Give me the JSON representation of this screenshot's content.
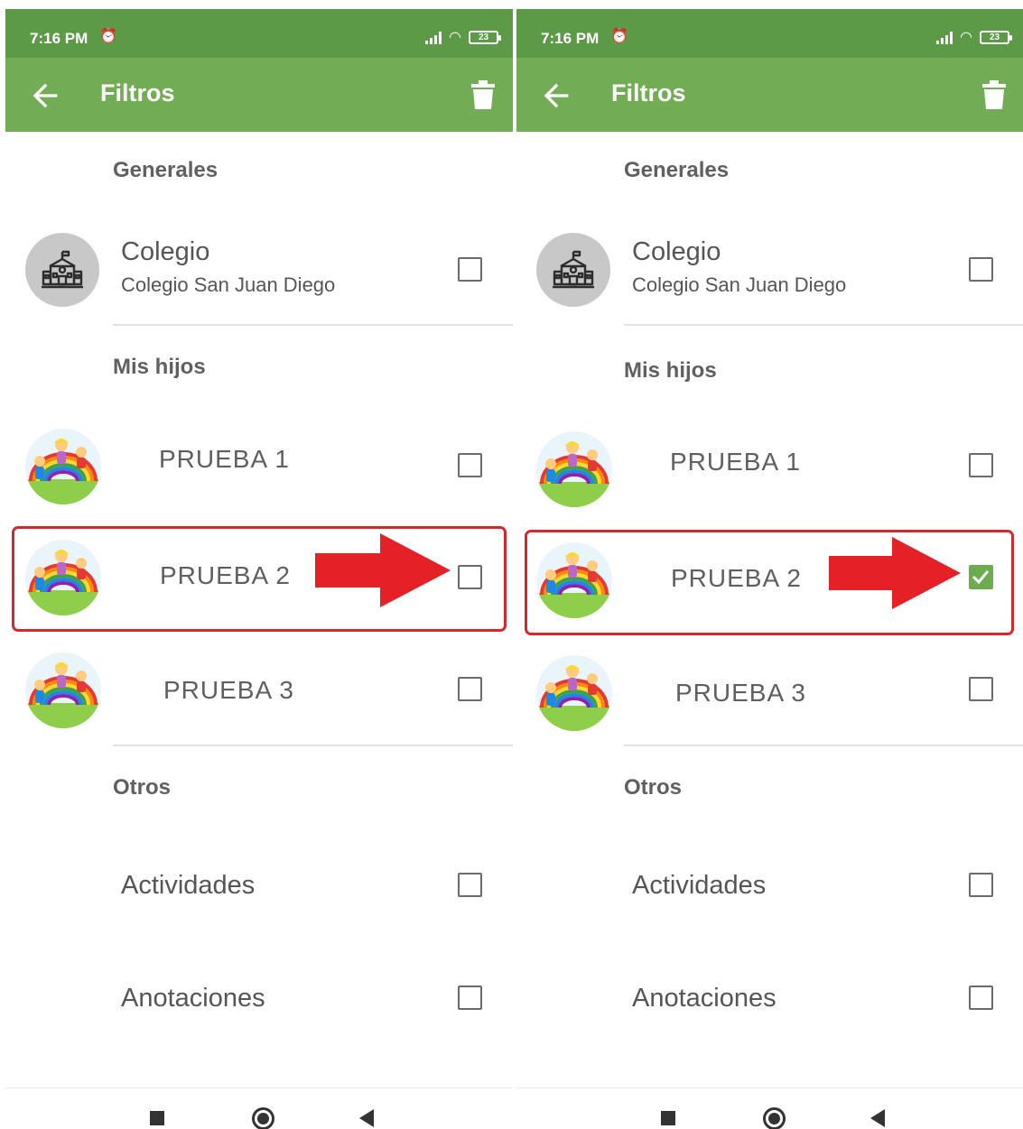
{
  "screens": [
    {
      "status_time": "7:16 PM",
      "battery": "23",
      "title": "Filtros",
      "sections": {
        "general": "Generales",
        "children": "Mis hijos",
        "others": "Otros"
      },
      "school": {
        "title": "Colegio",
        "subtitle": "Colegio San Juan Diego",
        "checked": false
      },
      "children": [
        {
          "name": "PRUEBA 1",
          "checked": false
        },
        {
          "name": "PRUEBA 2",
          "checked": false
        },
        {
          "name": "PRUEBA 3",
          "checked": false
        }
      ],
      "others": [
        {
          "label": "Actividades",
          "checked": false
        },
        {
          "label": "Anotaciones",
          "checked": false
        }
      ]
    },
    {
      "status_time": "7:16 PM",
      "battery": "23",
      "title": "Filtros",
      "sections": {
        "general": "Generales",
        "children": "Mis hijos",
        "others": "Otros"
      },
      "school": {
        "title": "Colegio",
        "subtitle": "Colegio San Juan Diego",
        "checked": false
      },
      "children": [
        {
          "name": "PRUEBA 1",
          "checked": false
        },
        {
          "name": "PRUEBA 2",
          "checked": true
        },
        {
          "name": "PRUEBA 3",
          "checked": false
        }
      ],
      "others": [
        {
          "label": "Actividades",
          "checked": false
        },
        {
          "label": "Anotaciones",
          "checked": false
        }
      ]
    }
  ],
  "icons": {
    "back": "arrow-back-icon",
    "trash": "trash-icon",
    "school": "school-building-icon",
    "child_avatar": "kids-rainbow-avatar",
    "annotation_arrow": "red-arrow-icon"
  },
  "colors": {
    "status_bar": "#5d9a47",
    "app_bar": "#72ad55",
    "checkbox_checked": "#6cab4e",
    "highlight": "#d3282e"
  }
}
